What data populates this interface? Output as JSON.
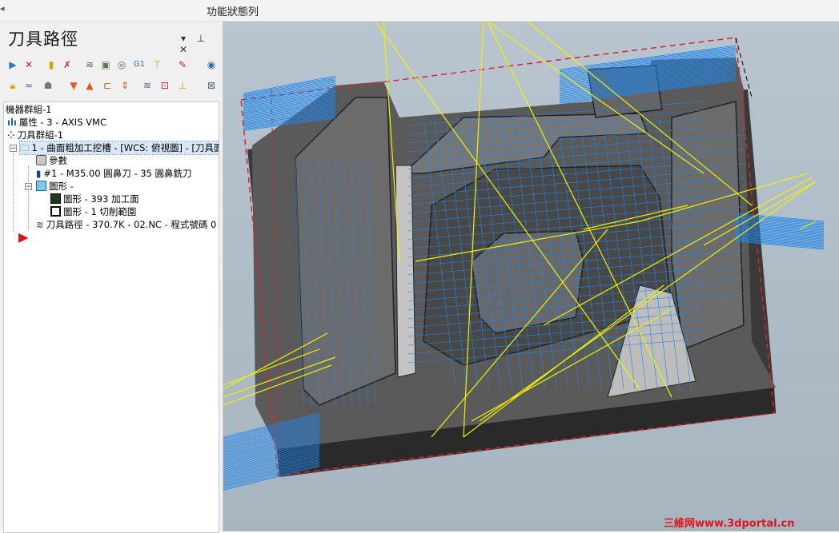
{
  "app": {
    "title": "功能狀態列"
  },
  "panel": {
    "title": "刀具路徑",
    "controls": {
      "dropdown": "▾",
      "pin": "⊥",
      "close": "✕"
    }
  },
  "toolbar": {
    "row1": [
      "select-all-icon",
      "deselect-icon",
      "regenerate-icon",
      "regenerate-dirty-icon",
      "backplot-icon",
      "verify-icon",
      "g1-icon",
      "post-icon",
      "tool-icon",
      "help-icon"
    ],
    "row2": [
      "lock-icon",
      "wave-icon",
      "ghost-icon",
      "move-down-icon",
      "move-up-icon",
      "insert-arrow-icon",
      "expand-icon",
      "display-icon",
      "dirty-icon",
      "filter-icon"
    ]
  },
  "tree": {
    "machine_group": "機器群組-1",
    "properties": "屬性 - 3 - AXIS VMC",
    "toolpath_group": "刀具群組-1",
    "operation": "1 - 曲面粗加工挖槽 - [WCS: 俯視圖] - [刀具面",
    "parameters": "參數",
    "tool": "#1 - M35.00 圓鼻刀 - 35 圓鼻銑刀",
    "geometry": "圖形 -",
    "geom_surfaces": "圖形 - 393 加工面",
    "geom_boundary": "圖形 - 1 切削範圍",
    "toolpath": "刀具路徑 - 370.7K - 02.NC - 程式號碼 0"
  },
  "colors": {
    "toolpath_blue": "#1f86ea",
    "rapid_yellow": "#f4f000",
    "boundary_red": "#e0202a",
    "part_dark": "#505050",
    "selection": "#d9e8f7"
  },
  "watermark": "三維网www.3dportal.cn"
}
